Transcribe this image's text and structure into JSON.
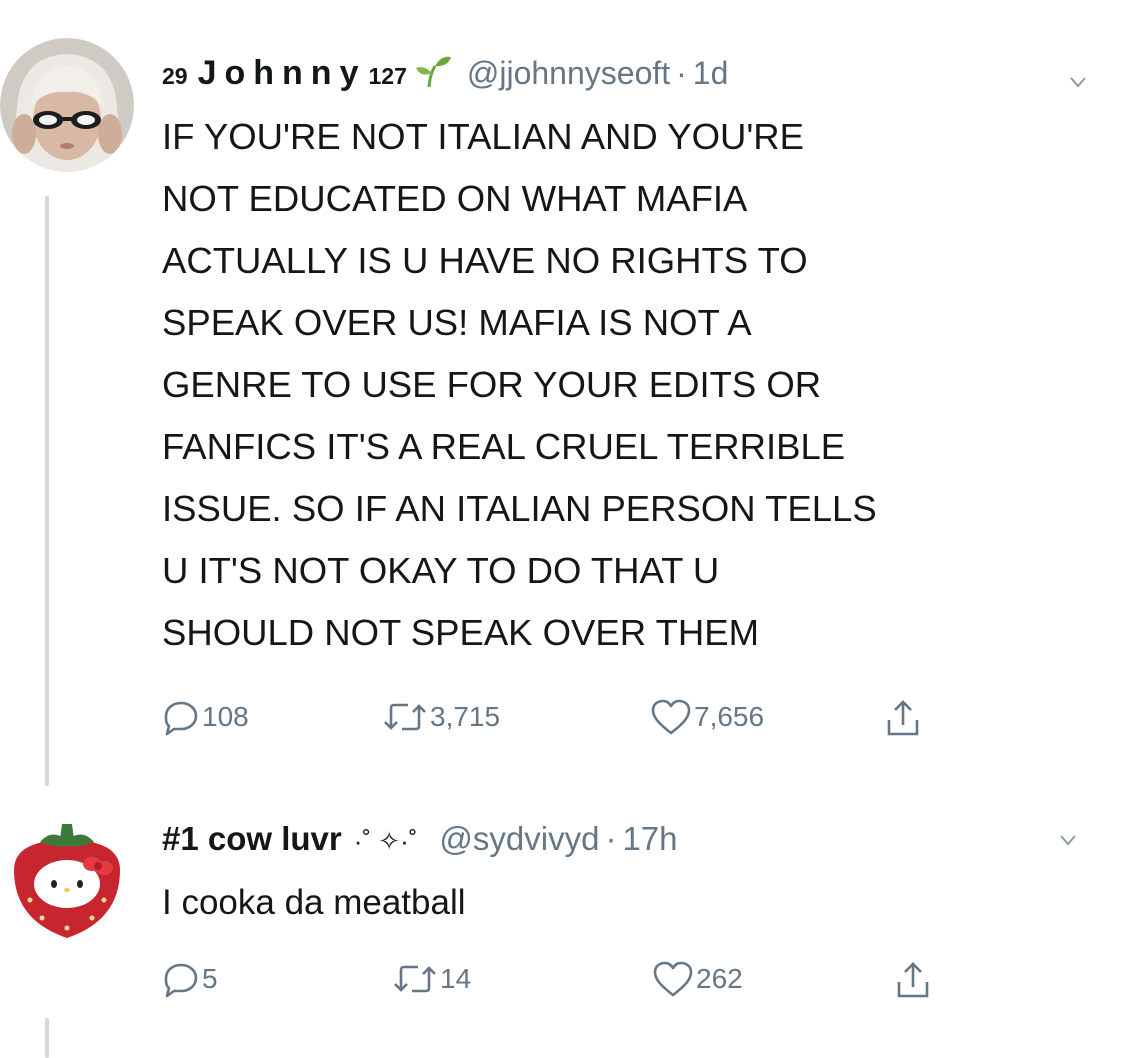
{
  "tweets": [
    {
      "name_prefix": "29",
      "display_name": "Johnny",
      "name_suffix": "127",
      "name_emoji": "seedling",
      "handle": "@jjohnnyseoft",
      "separator": "·",
      "time": "1d",
      "text_lines": [
        "IF YOU'RE NOT ITALIAN AND YOU'RE",
        "NOT EDUCATED ON WHAT MAFIA",
        "ACTUALLY IS U HAVE NO RIGHTS TO",
        "SPEAK OVER US! MAFIA IS NOT A",
        "GENRE TO USE FOR YOUR EDITS OR",
        "FANFICS IT'S A REAL CRUEL TERRIBLE",
        "ISSUE. SO IF AN ITALIAN PERSON TELLS",
        "U IT'S NOT OKAY TO DO THAT U",
        "SHOULD NOT SPEAK OVER THEM"
      ],
      "replies": "108",
      "retweets": "3,715",
      "likes": "7,656"
    },
    {
      "display_name": "#1 cow luvr",
      "name_decoration": "·˚ ✧·˚",
      "handle": "@sydvivyd",
      "separator": "·",
      "time": "17h",
      "text": "I cooka da meatball",
      "replies": "5",
      "retweets": "14",
      "likes": "262"
    }
  ],
  "colors": {
    "text": "#14171a",
    "secondary": "#657786",
    "thread_line": "#cfd9de",
    "seedling": "#6aa83b"
  }
}
